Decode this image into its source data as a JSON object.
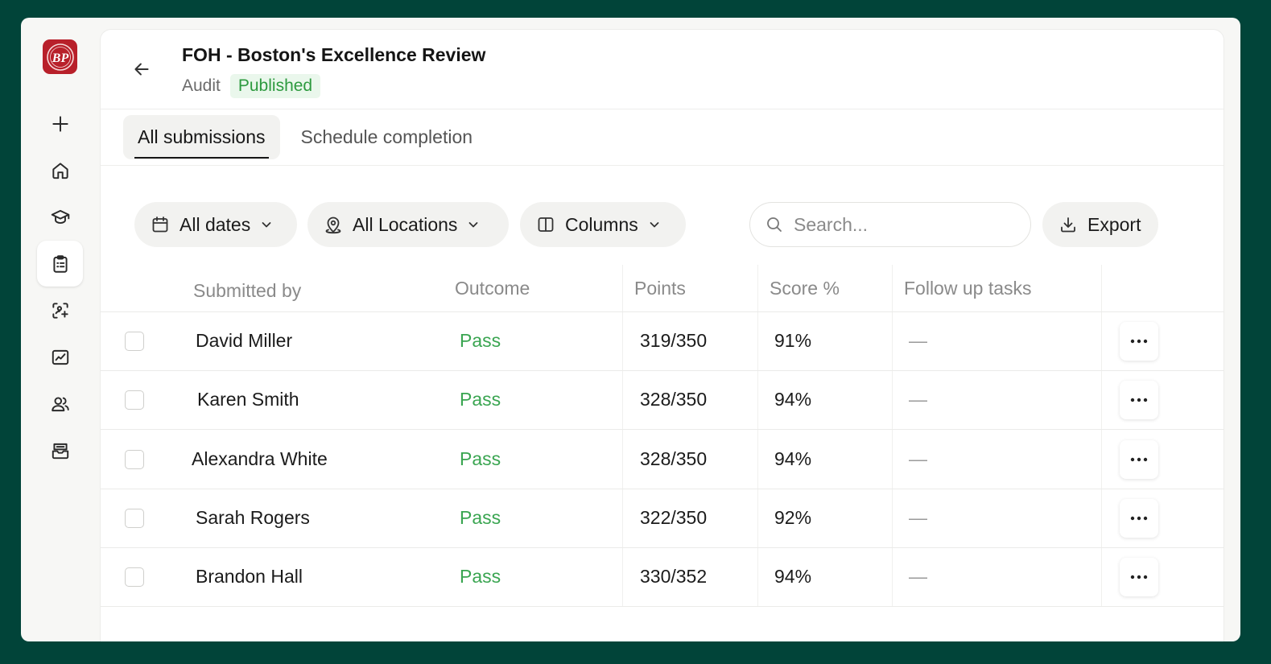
{
  "app": {
    "logo_text": "BP"
  },
  "header": {
    "title": "FOH - Boston's Excellence Review",
    "type": "Audit",
    "status": "Published"
  },
  "tabs": [
    {
      "label": "All submissions",
      "active": true
    },
    {
      "label": "Schedule completion",
      "active": false
    }
  ],
  "filters": {
    "dates": "All dates",
    "locations": "All Locations",
    "columns": "Columns",
    "search_placeholder": "Search...",
    "export": "Export"
  },
  "table": {
    "headers": [
      "Submitted by",
      "Outcome",
      "Points",
      "Score %",
      "Follow up tasks"
    ],
    "rows": [
      {
        "name": "David Miller",
        "outcome": "Pass",
        "points": "319/350",
        "score": "91%",
        "tasks": "—"
      },
      {
        "name": "Karen Smith",
        "outcome": "Pass",
        "points": "328/350",
        "score": "94%",
        "tasks": "—"
      },
      {
        "name": "Alexandra White",
        "outcome": "Pass",
        "points": "328/350",
        "score": "94%",
        "tasks": "—"
      },
      {
        "name": "Sarah Rogers",
        "outcome": "Pass",
        "points": "322/350",
        "score": "92%",
        "tasks": "—"
      },
      {
        "name": "Brandon Hall",
        "outcome": "Pass",
        "points": "330/352",
        "score": "94%",
        "tasks": "—"
      }
    ]
  },
  "colors": {
    "frame": "#014439",
    "brand": "#b8202a",
    "pass": "#3aa551",
    "published": "#2d9a3f"
  },
  "sidebar": {
    "icons": [
      "plus-icon",
      "home-icon",
      "graduation-cap-icon",
      "clipboard-icon",
      "scan-sparkle-icon",
      "chart-icon",
      "users-icon",
      "inbox-icon"
    ]
  }
}
